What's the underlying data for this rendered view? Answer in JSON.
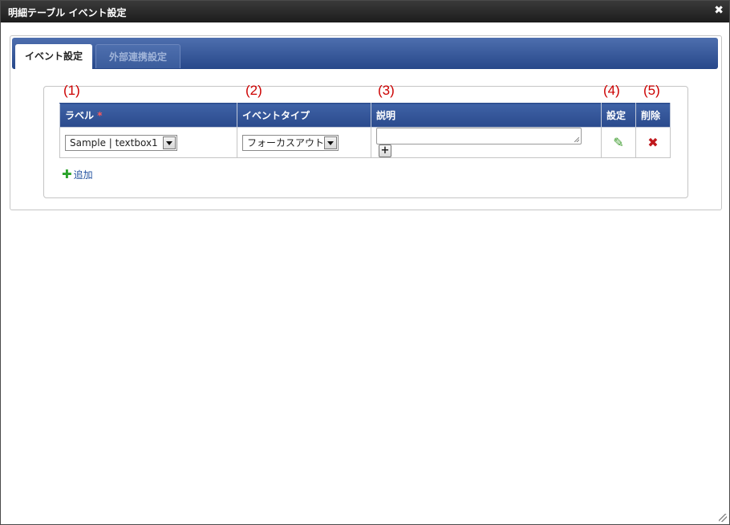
{
  "dialog": {
    "title": "明細テーブル イベント設定",
    "close_icon": "close-icon"
  },
  "tabs": [
    {
      "label": "イベント設定",
      "active": true
    },
    {
      "label": "外部連携設定",
      "active": false
    }
  ],
  "annotations": [
    "(1)",
    "(2)",
    "(3)",
    "(4)",
    "(5)"
  ],
  "table": {
    "columns": [
      "ラベル",
      "イベントタイプ",
      "説明",
      "設定",
      "削除"
    ],
    "required_mark": "*",
    "rows": [
      {
        "label_select": "Sample | textbox1",
        "event_type_select": "フォーカスアウト",
        "description": ""
      }
    ]
  },
  "add_link": {
    "label": "追加"
  },
  "colors": {
    "header_blue": "#2a4a8c",
    "annotation_red": "#cc0000",
    "edit_green": "#3a9a2a",
    "delete_red": "#c0181d"
  },
  "icons": {
    "edit": "pencil-icon",
    "delete": "delete-x-icon",
    "add": "plus-icon",
    "expand": "plus-button-icon"
  }
}
